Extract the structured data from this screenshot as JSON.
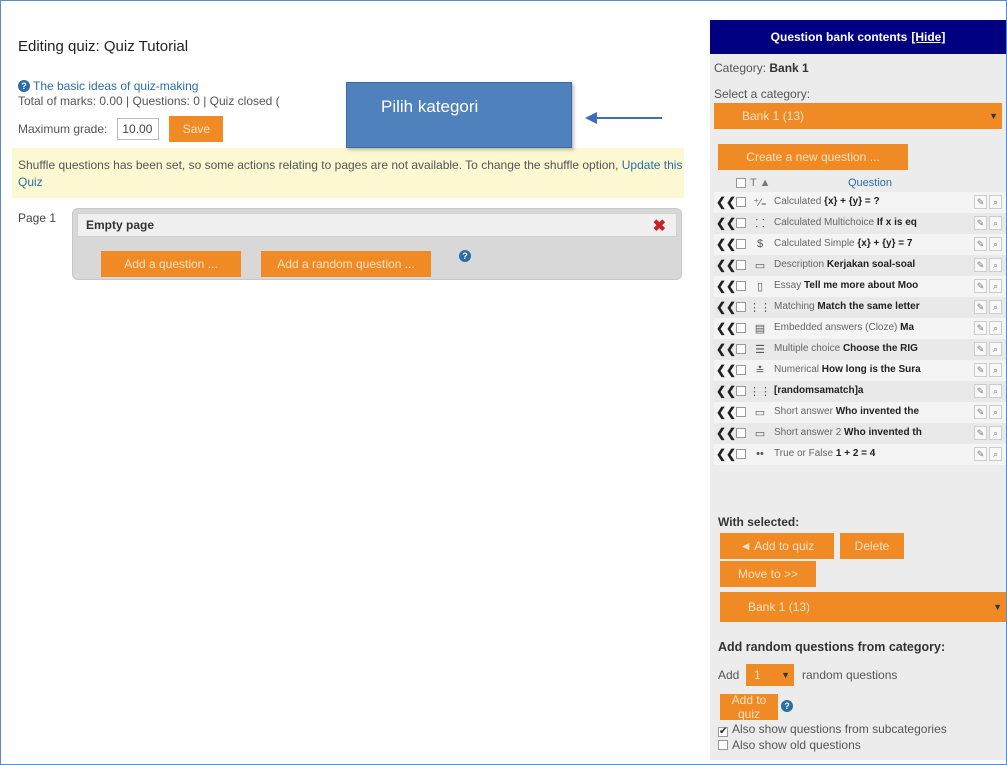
{
  "left": {
    "title": "Editing quiz: Quiz Tutorial",
    "help_link": "The basic ideas of quiz-making",
    "marks_info": "Total of marks: 0.00 | Questions: 0 | Quiz closed (",
    "max_grade_label": "Maximum grade:",
    "max_grade_value": "10.00",
    "save_label": "Save",
    "notice_text": "Shuffle questions has been set, so some actions relating to pages are not available. To change the shuffle option,",
    "notice_link": "Update this Quiz",
    "page_label": "Page 1",
    "page_box_title": "Empty page",
    "add_question_label": "Add a question ...",
    "add_random_label": "Add a random question ..."
  },
  "callout": {
    "text": "Pilih kategori"
  },
  "question_bank": {
    "header_title": "Question bank contents",
    "hide_link": "[Hide]",
    "category_label": "Category:",
    "category_value": "Bank 1",
    "select_category_label": "Select a category:",
    "selected_category": "Bank 1 (13)",
    "create_button": "Create a new question ...",
    "list_header_t": "T",
    "list_header_question": "Question",
    "questions": [
      {
        "type": "Calculated",
        "name": "{x} + {y} = ?",
        "icon": "calculated-icon",
        "glyph": "⁺⁄₌"
      },
      {
        "type": "Calculated Multichoice",
        "name": "If x is eq",
        "icon": "calculated-multichoice-icon",
        "glyph": "⸬"
      },
      {
        "type": "Calculated Simple",
        "name": "{x} + {y} = 7",
        "icon": "calculated-simple-icon",
        "glyph": "$"
      },
      {
        "type": "Description",
        "name": "Kerjakan soal-soal",
        "icon": "description-icon",
        "glyph": "▭"
      },
      {
        "type": "Essay",
        "name": "Tell me more about Moo",
        "icon": "essay-icon",
        "glyph": "▯"
      },
      {
        "type": "Matching",
        "name": "Match the same letter",
        "icon": "matching-icon",
        "glyph": "⋮⋮"
      },
      {
        "type": "Embedded answers (Cloze)",
        "name": "Ma",
        "icon": "cloze-icon",
        "glyph": "▤"
      },
      {
        "type": "Multiple choice",
        "name": "Choose the RIG",
        "icon": "multichoice-icon",
        "glyph": "☰"
      },
      {
        "type": "Numerical",
        "name": "How long is the Sura",
        "icon": "numerical-icon",
        "glyph": "≛"
      },
      {
        "type": "",
        "name": "[randomsamatch]a",
        "icon": "random-match-icon",
        "glyph": "⋮⋮"
      },
      {
        "type": "Short answer",
        "name": "Who invented the",
        "icon": "short-answer-icon",
        "glyph": "▭"
      },
      {
        "type": "Short answer 2",
        "name": "Who invented th",
        "icon": "short-answer-icon",
        "glyph": "▭"
      },
      {
        "type": "True or False",
        "name": "1 + 2 = 4",
        "icon": "true-false-icon",
        "glyph": "••"
      }
    ],
    "with_selected_label": "With selected:",
    "add_to_quiz_label": "◄ Add to quiz",
    "delete_label": "Delete",
    "move_to_label": "Move to >>",
    "move_target_category": "Bank 1 (13)",
    "random_heading": "Add random questions from category:",
    "random_add_label": "Add",
    "random_count_value": "1",
    "random_suffix_label": "random questions",
    "add_to_quiz_short": "Add to quiz",
    "show_subcategories_label": "Also show questions from subcategories",
    "show_subcategories_checked": true,
    "show_old_label": "Also show old questions",
    "show_old_checked": false
  },
  "colors": {
    "accent_orange": "#f08a24",
    "header_navy": "#000080",
    "link_blue": "#2a6ea6",
    "callout_blue": "#4f81bd",
    "notice_yellow": "#fbf8d2",
    "delete_red": "#cc1f1f"
  }
}
